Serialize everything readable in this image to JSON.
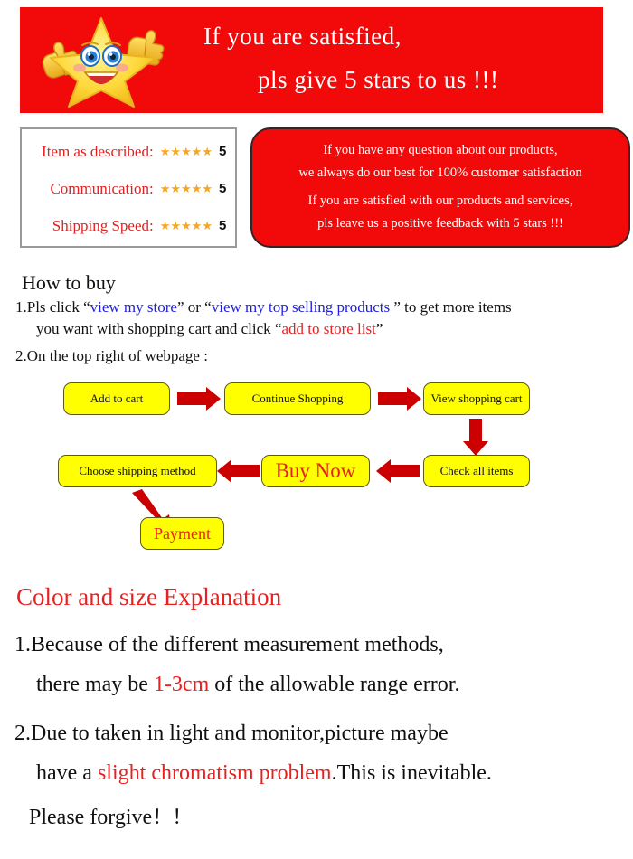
{
  "banner": {
    "line1": "If you are satisfied,",
    "line2": "pls give 5 stars to us !!!",
    "bg_color": "#f20a0a",
    "text_color": "#ffffff",
    "mascot_icon": "star-thumbs-up-mascot-icon"
  },
  "ratings": {
    "rows": [
      {
        "label": "Item as described:",
        "stars": "★★★★★",
        "score": "5"
      },
      {
        "label": "Communication:",
        "stars": "★★★★★",
        "score": "5"
      },
      {
        "label": "Shipping Speed:",
        "stars": "★★★★★",
        "score": "5"
      }
    ],
    "label_color": "#e02222",
    "star_color": "#f5a623"
  },
  "note": {
    "line1": "If you have any question about our products,",
    "line2": "we always do our best for 100% customer satisfaction",
    "line3": "If you are satisfied with our products and services,",
    "line4": "pls leave us a positive feedback with 5 stars !!!",
    "bg_color": "#f20a0a"
  },
  "howto": {
    "title": "How to buy",
    "item1_a": "1.Pls click “",
    "item1_link1": "view my store",
    "item1_b": "” or “",
    "item1_link2": "view my top selling products",
    "item1_c": " ” to get more items",
    "item1_d": "you want with shopping cart and click “",
    "item1_link3": "add to store list",
    "item1_e": "”",
    "item2": "2.On the top right of webpage :"
  },
  "flowchart": {
    "boxes": [
      {
        "id": "add-to-cart",
        "label": "Add to cart"
      },
      {
        "id": "continue-shopping",
        "label": "Continue Shopping"
      },
      {
        "id": "view-shopping-cart",
        "label": "View shopping cart"
      },
      {
        "id": "check-all-items",
        "label": "Check all items"
      },
      {
        "id": "buy-now",
        "label": "Buy Now"
      },
      {
        "id": "choose-shipping-method",
        "label": "Choose shipping method"
      },
      {
        "id": "payment",
        "label": "Payment"
      }
    ],
    "box_bg": "#ffff00",
    "arrow_color": "#cc0000",
    "highlight_color": "#e82020"
  },
  "color_size": {
    "title": "Color and size Explanation",
    "l1": "1.Because of the different measurement methods,",
    "l2_a": "there may be ",
    "l2_hl": "1-3cm",
    "l2_b": " of the allowable range error.",
    "l3": "2.Due to taken in light and monitor,picture maybe",
    "l4_a": "have a ",
    "l4_hl": "slight chromatism problem",
    "l4_b": ".This is inevitable.",
    "l5_a": "Please forgive",
    "l5_b": "！！",
    "title_color": "#e82020"
  }
}
